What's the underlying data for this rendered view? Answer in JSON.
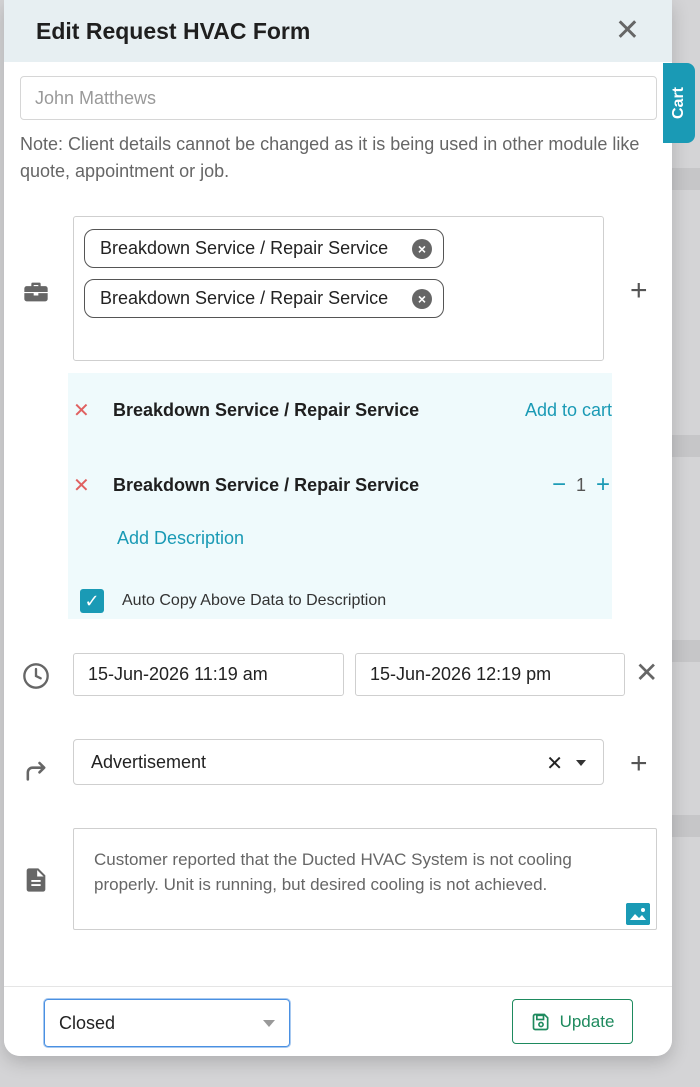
{
  "modal": {
    "title": "Edit Request HVAC Form",
    "close_icon": "close-icon"
  },
  "cart_tab": {
    "label": "Cart"
  },
  "client": {
    "placeholder": "John Matthews",
    "note": "Note: Client details cannot be changed as it is being used in other module like quote, appointment or job."
  },
  "services": {
    "icon": "briefcase-icon",
    "chips": [
      {
        "label": "Breakdown Service / Repair Service"
      },
      {
        "label": "Breakdown Service / Repair Service"
      }
    ]
  },
  "cart": {
    "rows": [
      {
        "name": "Breakdown Service / Repair Service",
        "action": "Add to cart"
      },
      {
        "name": "Breakdown Service / Repair Service",
        "qty_minus": "−",
        "qty": "1",
        "qty_plus": "+"
      }
    ],
    "add_description": "Add Description",
    "auto_copy_label": "Auto Copy Above Data to Description",
    "auto_copy_checked": true
  },
  "schedule": {
    "icon": "clock-icon",
    "start": "15-Jun-2026 11:19 am",
    "end": "15-Jun-2026 12:19 pm"
  },
  "source": {
    "icon": "redirect-arrow-icon",
    "value": "Advertisement"
  },
  "description": {
    "icon": "document-icon",
    "text": "Customer reported that the Ducted HVAC System is not cooling properly. Unit is running, but desired cooling is not achieved."
  },
  "footer": {
    "status": "Closed",
    "update_label": "Update"
  },
  "colors": {
    "accent": "#1a9ab5",
    "update_green": "#1e8a5e",
    "remove_red": "#e06060"
  }
}
